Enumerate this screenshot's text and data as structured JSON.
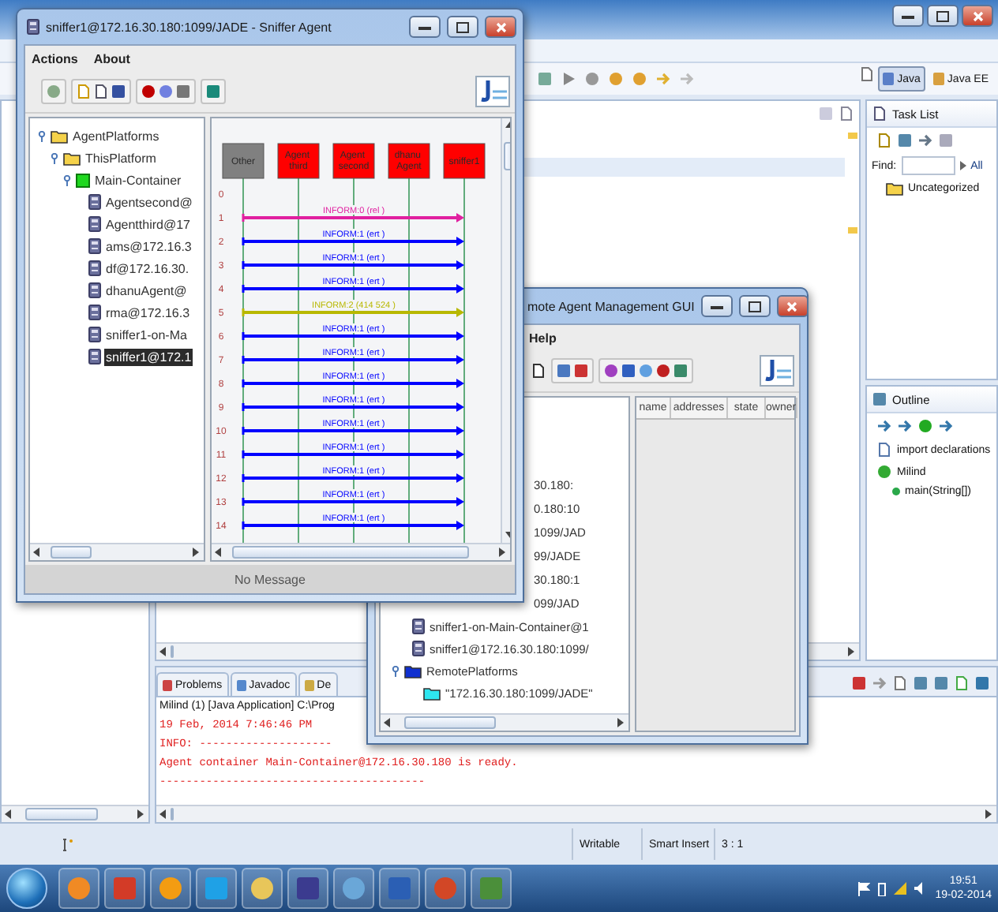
{
  "sniffer": {
    "title": "sniffer1@172.16.30.180:1099/JADE - Sniffer Agent",
    "menu": [
      "Actions",
      "About"
    ],
    "tree": [
      {
        "label": "AgentPlatforms",
        "kind": "folder",
        "expanded": true,
        "selected": false,
        "children": [
          {
            "label": "ThisPlatform",
            "kind": "folder",
            "expanded": true,
            "selected": false,
            "children": [
              {
                "label": "Main-Container",
                "kind": "container",
                "expanded": true,
                "selected": false,
                "children": [
                  {
                    "label": "Agentsecond@",
                    "kind": "agent",
                    "selected": false
                  },
                  {
                    "label": "Agentthird@17",
                    "kind": "agent",
                    "selected": false
                  },
                  {
                    "label": "ams@172.16.3",
                    "kind": "agent",
                    "selected": false
                  },
                  {
                    "label": "df@172.16.30.",
                    "kind": "agent",
                    "selected": false
                  },
                  {
                    "label": "dhanuAgent@",
                    "kind": "agent",
                    "selected": false
                  },
                  {
                    "label": "rma@172.16.3",
                    "kind": "agent",
                    "selected": false
                  },
                  {
                    "label": "sniffer1-on-Ma",
                    "kind": "agent",
                    "selected": false
                  },
                  {
                    "label": "sniffer1@172.1",
                    "kind": "agent",
                    "selected": true
                  }
                ]
              }
            ]
          }
        ]
      }
    ],
    "agents": [
      {
        "label": "Other",
        "color": "#808080"
      },
      {
        "label": "Agent third",
        "color": "#ff0000"
      },
      {
        "label": "Agent second",
        "color": "#ff0000"
      },
      {
        "label": "dhanu Agent",
        "color": "#ff0000"
      },
      {
        "label": "sniffer1",
        "color": "#ff0000"
      }
    ],
    "rows": [
      {
        "number": "0"
      },
      {
        "number": "1",
        "message": "INFORM:0 (rel )",
        "color": "#e020a0"
      },
      {
        "number": "2",
        "message": "INFORM:1 (ert )",
        "color": "#0000ff"
      },
      {
        "number": "3",
        "message": "INFORM:1 (ert )",
        "color": "#0000ff"
      },
      {
        "number": "4",
        "message": "INFORM:1 (ert )",
        "color": "#0000ff"
      },
      {
        "number": "5",
        "message": "INFORM:2 (414 524 )",
        "color": "#b8b800"
      },
      {
        "number": "6",
        "message": "INFORM:1 (ert )",
        "color": "#0000ff"
      },
      {
        "number": "7",
        "message": "INFORM:1 (ert )",
        "color": "#0000ff"
      },
      {
        "number": "8",
        "message": "INFORM:1 (ert )",
        "color": "#0000ff"
      },
      {
        "number": "9",
        "message": "INFORM:1 (ert )",
        "color": "#0000ff"
      },
      {
        "number": "10",
        "message": "INFORM:1 (ert )",
        "color": "#0000ff"
      },
      {
        "number": "11",
        "message": "INFORM:1 (ert )",
        "color": "#0000ff"
      },
      {
        "number": "12",
        "message": "INFORM:1 (ert )",
        "color": "#0000ff"
      },
      {
        "number": "13",
        "message": "INFORM:1 (ert )",
        "color": "#0000ff"
      },
      {
        "number": "14",
        "message": "INFORM:1 (ert )",
        "color": "#0000ff"
      }
    ],
    "status": "No Message"
  },
  "rma": {
    "title": "mote Agent Management GUI",
    "menu": [
      "Help"
    ],
    "tree": [
      {
        "label": "30.180:",
        "kind": "fragment"
      },
      {
        "label": "0.180:10",
        "kind": "fragment"
      },
      {
        "label": "1099/JAD",
        "kind": "fragment"
      },
      {
        "label": "99/JADE",
        "kind": "fragment"
      },
      {
        "label": "30.180:1",
        "kind": "fragment"
      },
      {
        "label": "099/JAD",
        "kind": "fragment"
      },
      {
        "label": "sniffer1-on-Main-Container@1",
        "kind": "agent"
      },
      {
        "label": "sniffer1@172.16.30.180:1099/",
        "kind": "agent"
      },
      {
        "label": "RemotePlatforms",
        "kind": "remote",
        "expanded": true,
        "children": [
          {
            "label": "\"172.16.30.180:1099/JADE\"",
            "kind": "platform"
          }
        ]
      }
    ],
    "columns": [
      "name",
      "addresses",
      "state",
      "owner"
    ]
  },
  "eclipse": {
    "perspectives": [
      {
        "label": "Java",
        "selected": true
      },
      {
        "label": "Java EE",
        "selected": false
      }
    ],
    "task_list": {
      "title": "Task List",
      "find_label": "Find:",
      "filter": "All",
      "items": [
        "Uncategorized"
      ]
    },
    "outline": {
      "title": "Outline",
      "items": [
        {
          "label": "import declarations",
          "kind": "imports"
        },
        {
          "label": "Milind",
          "kind": "class",
          "children": [
            {
              "label": "main(String[])",
              "kind": "method"
            }
          ]
        }
      ]
    },
    "console": {
      "tabs": [
        {
          "label": "Problems",
          "selected": false
        },
        {
          "label": "Javadoc",
          "selected": false
        },
        {
          "label": "De",
          "selected": false
        }
      ],
      "header": "Milind (1) [Java Application] C:\\Prog",
      "lines": [
        "19 Feb, 2014 7:46:46 PM",
        "INFO: --------------------",
        "Agent container Main-Container@172.16.30.180 is ready.",
        "----------------------------------------"
      ]
    },
    "status_bar": [
      "Writable",
      "Smart Insert",
      "3 : 1"
    ]
  },
  "taskbar": {
    "time": "19:51",
    "date": "19-02-2014"
  }
}
